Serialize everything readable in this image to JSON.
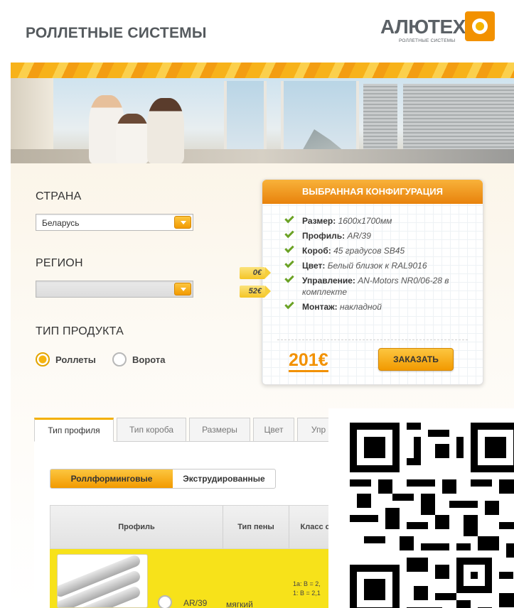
{
  "header": {
    "title": "РОЛЛЕТНЫЕ СИСТЕМЫ",
    "logo_text": "АЛЮТЕХ",
    "logo_subtitle": "РОЛЛЕТНЫЕ СИСТЕМЫ"
  },
  "filters": {
    "country_label": "СТРАНА",
    "country_value": "Беларусь",
    "region_label": "РЕГИОН",
    "region_value": "",
    "product_type_label": "ТИП ПРОДУКТА",
    "product_options": [
      {
        "label": "Роллеты",
        "checked": true
      },
      {
        "label": "Ворота",
        "checked": false
      }
    ]
  },
  "config": {
    "title": "ВЫБРАННАЯ КОНФИГУРАЦИЯ",
    "items": [
      {
        "key": "Размер:",
        "value": "1600x1700мм"
      },
      {
        "key": "Профиль:",
        "value": "AR/39"
      },
      {
        "key": "Короб:",
        "value": "45 градусов SB45"
      },
      {
        "key": "Цвет:",
        "value": "Белый близок к RAL9016",
        "price": "0€"
      },
      {
        "key": "Управление:",
        "value": "AN-Motors NR0/06-28 в комплекте",
        "price": "52€"
      },
      {
        "key": "Монтаж:",
        "value": "накладной"
      }
    ],
    "total": "201€",
    "order_label": "ЗАКАЗАТЬ"
  },
  "tabs": [
    "Тип профиля",
    "Тип короба",
    "Размеры",
    "Цвет",
    "Упр"
  ],
  "profile_types": [
    "Роллформинговые",
    "Экструдированные"
  ],
  "table": {
    "headers": [
      "Профиль",
      "Тип пены",
      "Класс со"
    ],
    "row": {
      "profile": "AR/39",
      "foam": "мягкий",
      "class_lines": [
        "1a: B = 2,",
        "1: B = 2,1"
      ]
    }
  },
  "colors": {
    "accent": "#f29100",
    "button": "#fcc640",
    "check": "#6ba225",
    "row_highlight": "#f7e21a"
  }
}
